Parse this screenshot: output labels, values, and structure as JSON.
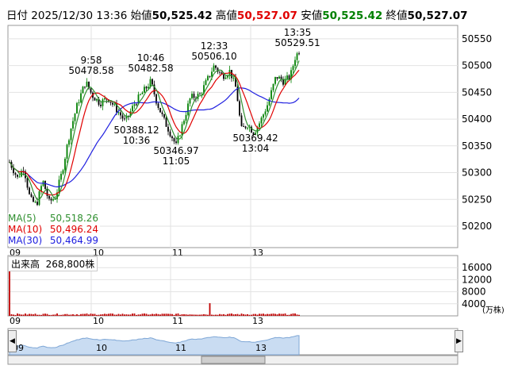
{
  "header": {
    "label_date": "日付",
    "date": "2025/12/30",
    "time": "13:36",
    "label_open": "始値",
    "open": "50,525.42",
    "label_high": "高値",
    "high": "50,527.07",
    "label_low": "安値",
    "low": "50,525.42",
    "label_close": "終値",
    "close": "50,527.07"
  },
  "colors": {
    "up": "#008000",
    "down": "#000000",
    "ma5": "#2f8f2f",
    "ma10": "#e00000",
    "ma30": "#2020e0",
    "volume": "#c00000",
    "high_text": "#e00000",
    "low_text": "#008000"
  },
  "price_axis": {
    "ticks": [
      "50550",
      "50500",
      "50450",
      "50400",
      "50350",
      "50300",
      "50250",
      "50200"
    ]
  },
  "volume_axis": {
    "ticks": [
      "16000",
      "12000",
      "8000",
      "4000"
    ],
    "unit": "(万株)"
  },
  "time_axis": {
    "labels": [
      "09",
      "10",
      "11",
      "13"
    ]
  },
  "annotations": [
    {
      "time": "9:58",
      "value": "50478.58"
    },
    {
      "time": "10:46",
      "value": "50482.58"
    },
    {
      "time": "12:33",
      "value": "50506.10"
    },
    {
      "time": "13:35",
      "value": "50529.51"
    },
    {
      "value": "50388.12",
      "time": "10:36"
    },
    {
      "value": "50346.97",
      "time": "11:05"
    },
    {
      "value": "50369.42",
      "time": "13:04"
    }
  ],
  "ma": {
    "ma5_label": "MA(5)",
    "ma5_value": "50,518.26",
    "ma10_label": "MA(10)",
    "ma10_value": "50,496.24",
    "ma30_label": "MA(30)",
    "ma30_value": "50,464.99"
  },
  "volume": {
    "label": "出来高",
    "value": "268,800株"
  },
  "navigator": {
    "labels": [
      "09",
      "10",
      "11",
      "13"
    ],
    "left_arrow": "◀",
    "right_arrow": "▶"
  }
}
